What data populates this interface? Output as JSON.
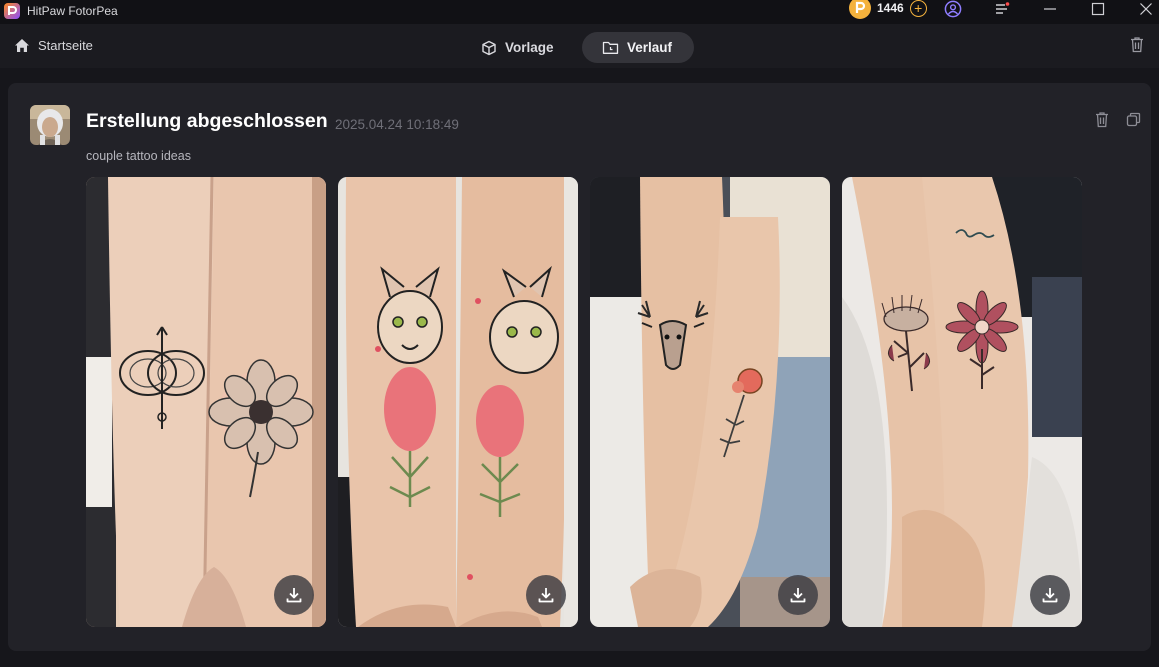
{
  "app": {
    "title": "HitPaw FotorPea",
    "coins": "1446",
    "icons": [
      "coin-icon",
      "add-coin-icon",
      "user-icon",
      "menu-icon",
      "minimize-icon",
      "maximize-icon",
      "close-icon"
    ]
  },
  "nav": {
    "home_label": "Startseite",
    "tabs": [
      {
        "label": "Vorlage",
        "active": false
      },
      {
        "label": "Verlauf",
        "active": true
      }
    ]
  },
  "record": {
    "title": "Erstellung abgeschlossen",
    "timestamp": "2025.04.24 10:18:49",
    "prompt": "couple tattoo ideas",
    "images": [
      {
        "subject": "butterfly and flower forearm tattoos"
      },
      {
        "subject": "matching cat and floral forearm tattoos"
      },
      {
        "subject": "deer head and red flower forearm tattoos"
      },
      {
        "subject": "thistle and dahlia forearm tattoos with script"
      }
    ]
  },
  "colors": {
    "accent_coin": "#f4b23d",
    "brand_purple": "#8a4dff",
    "brand_orange": "#ff8a1e",
    "active_tab": "#34343a",
    "card": "#222228",
    "background": "#16161b"
  }
}
